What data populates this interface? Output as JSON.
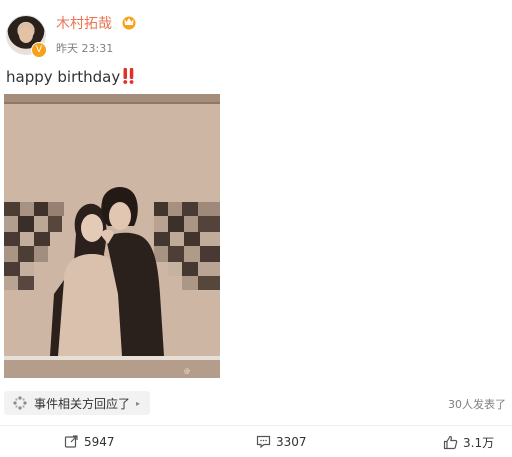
{
  "post": {
    "author": "木村拓哉",
    "time": "昨天 23:31",
    "text": "happy birthday",
    "image_alt": "Photo of two people posing in front of a patterned wall, mosaic-blurred background"
  },
  "event": {
    "label": "事件相关方回应了",
    "comments_note": "30人发表了"
  },
  "actions": {
    "repost_count": "5947",
    "comment_count": "3307",
    "like_count": "3.1万"
  },
  "colors": {
    "username": "#eb7350",
    "badge": "#f7a21b",
    "meta": "#808080"
  }
}
